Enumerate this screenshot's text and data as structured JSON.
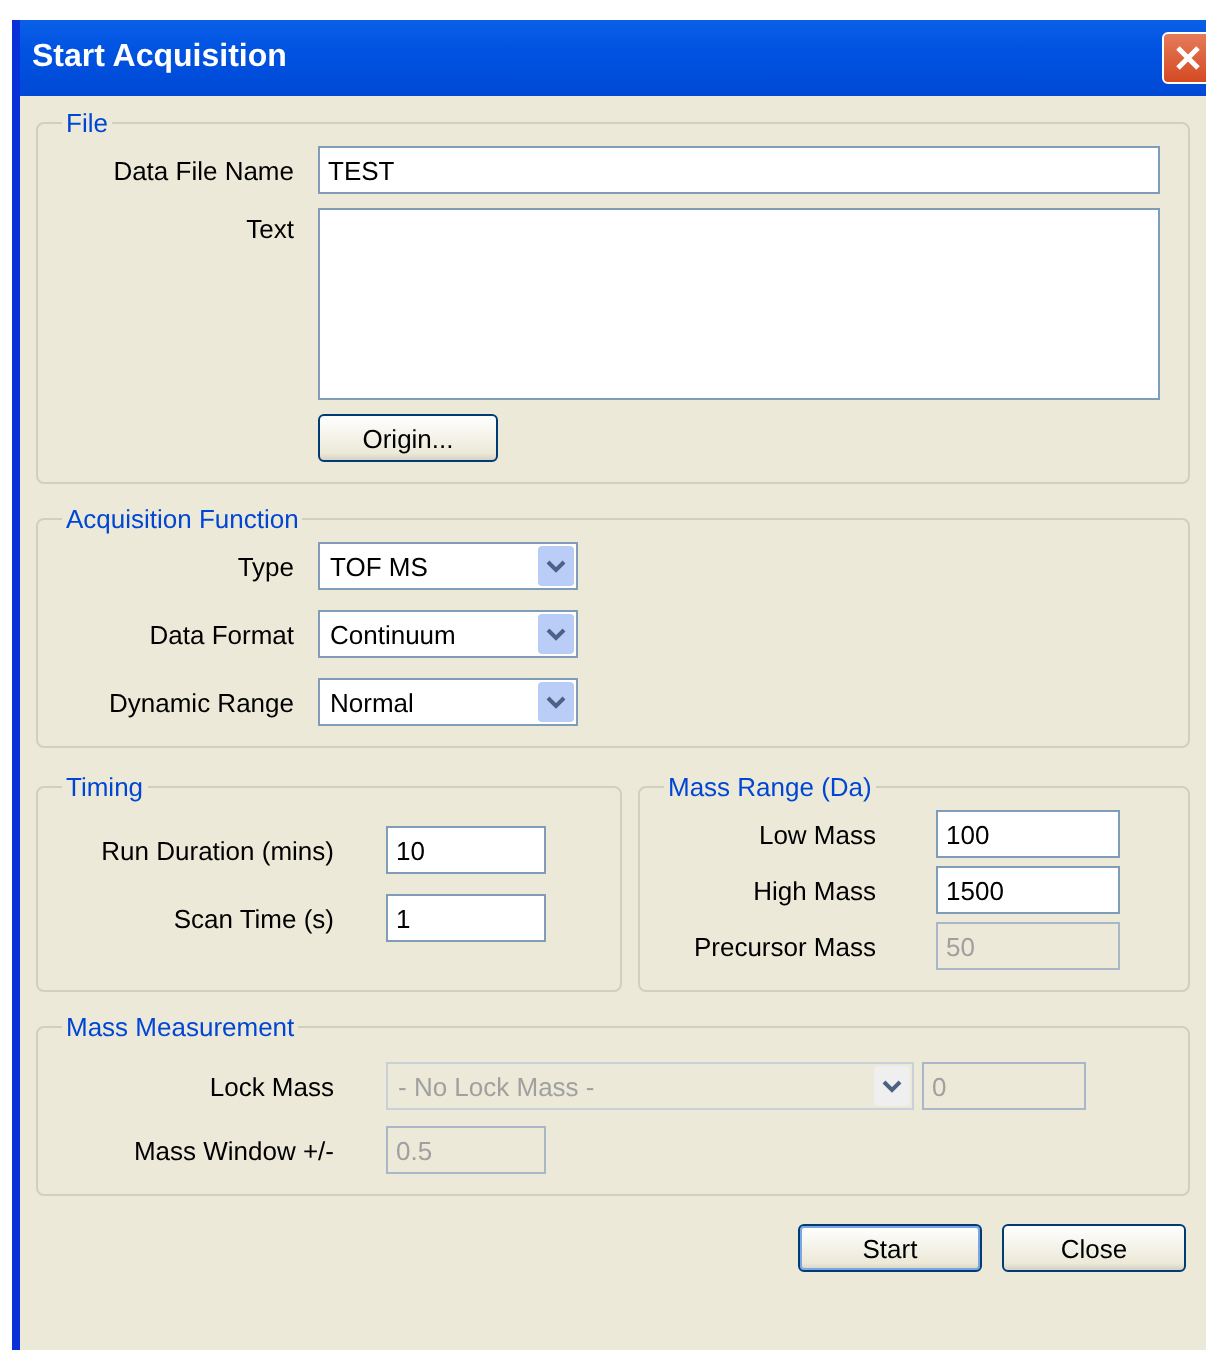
{
  "window": {
    "title": "Start Acquisition"
  },
  "file": {
    "title": "File",
    "fields": [
      {
        "label": "Data File Name",
        "kind": "line",
        "value": "TEST"
      },
      {
        "label": "Text",
        "kind": "area"
      }
    ],
    "button": "Origin..."
  },
  "acquisition_function": {
    "title": "Acquisition Function",
    "selects": [
      {
        "label": "Type",
        "value": "TOF MS"
      },
      {
        "label": "Data Format",
        "value": "Continuum"
      },
      {
        "label": "Dynamic Range",
        "value": "Normal"
      }
    ]
  },
  "timing": {
    "title": "Timing",
    "fields": [
      {
        "label": "Run Duration (mins)",
        "value": "10",
        "disabled": false
      },
      {
        "label": "Scan Time (s)",
        "value": "1",
        "disabled": false
      }
    ]
  },
  "mass_range": {
    "title": "Mass Range (Da)",
    "fields": [
      {
        "label": "Low Mass",
        "value": "100",
        "disabled": false
      },
      {
        "label": "High Mass",
        "value": "1500",
        "disabled": false
      },
      {
        "label": "Precursor Mass",
        "value": "50",
        "disabled": true
      }
    ]
  },
  "mass_measurement": {
    "title": "Mass Measurement",
    "lock_mass": {
      "label": "Lock Mass",
      "value": "- No Lock Mass -",
      "disabled": true,
      "extra_value": "0"
    },
    "mass_window": {
      "label": "Mass Window +/-",
      "value": "0.5",
      "disabled": true
    }
  },
  "buttons": [
    {
      "label": "Start",
      "default": true
    },
    {
      "label": "Close",
      "default": false
    }
  ]
}
